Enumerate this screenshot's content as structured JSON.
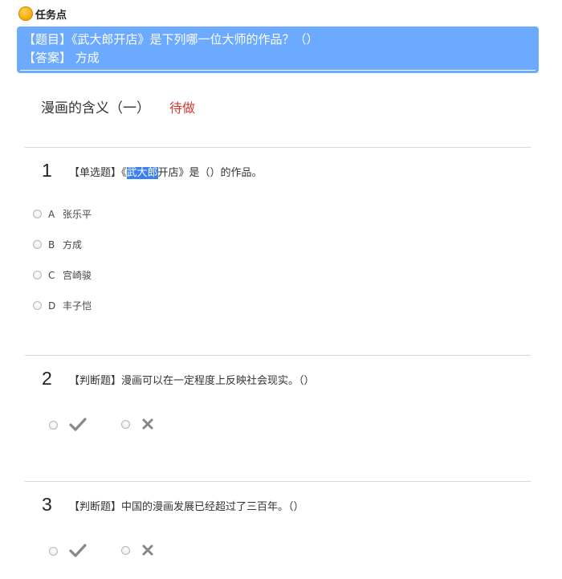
{
  "header": {
    "title": "任务点",
    "icon": "task-point-icon"
  },
  "answer_box": {
    "question_line": "【题目】《武大郎开店》是下列哪一位大师的作品？（）",
    "answer_line": "【答案】 方成",
    "background": "#6caaff"
  },
  "section": {
    "title": "漫画的含义（一）",
    "status": "待做",
    "status_color": "#d33a33"
  },
  "questions": [
    {
      "number": "1",
      "type": "【单选题】",
      "text_prefix": "《",
      "text_highlight": "武大郎",
      "text_suffix": "开店》是（）的作品。",
      "options": [
        {
          "letter": "A",
          "text": "张乐平"
        },
        {
          "letter": "B",
          "text": "方成"
        },
        {
          "letter": "C",
          "text": "宫崎骏"
        },
        {
          "letter": "D",
          "text": "丰子恺"
        }
      ]
    },
    {
      "number": "2",
      "type": "【判断题】",
      "text": "漫画可以在一定程度上反映社会现实。（）",
      "choices": [
        "check-icon",
        "cross-icon"
      ]
    },
    {
      "number": "3",
      "type": "【判断题】",
      "text": "中国的漫画发展已经超过了三百年。（）",
      "choices": [
        "check-icon",
        "cross-icon"
      ]
    }
  ]
}
